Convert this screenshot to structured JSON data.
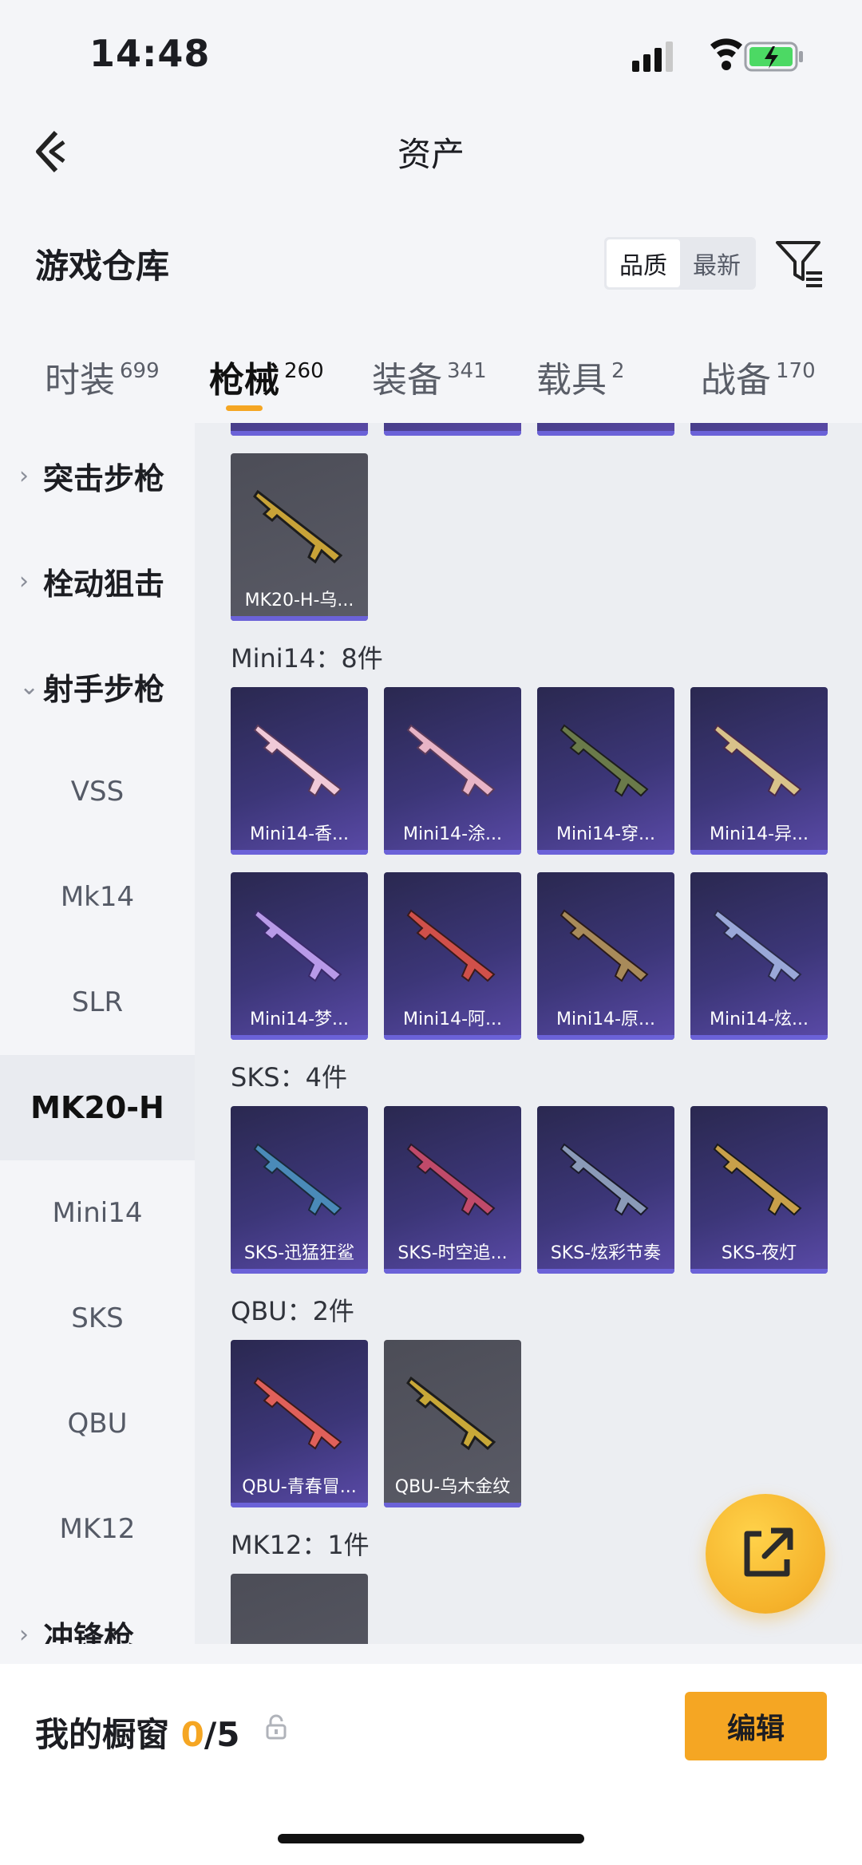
{
  "status_bar": {
    "time": "14:48"
  },
  "nav": {
    "title": "资产"
  },
  "header": {
    "title": "游戏仓库",
    "sort_options": [
      "品质",
      "最新"
    ]
  },
  "tabs": [
    {
      "label": "时装",
      "count": "699"
    },
    {
      "label": "枪械",
      "count": "260"
    },
    {
      "label": "装备",
      "count": "341"
    },
    {
      "label": "载具",
      "count": "2"
    },
    {
      "label": "战备",
      "count": "170"
    }
  ],
  "sidebar": {
    "categories": [
      "突击步枪",
      "栓动狙击",
      "射手步枪",
      "冲锋枪"
    ],
    "subitems": [
      "VSS",
      "Mk14",
      "SLR",
      "MK20-H",
      "Mini14",
      "SKS",
      "QBU",
      "MK12"
    ]
  },
  "groups": {
    "mk20h": {
      "items": [
        "MK20-H-乌..."
      ]
    },
    "mini14": {
      "label": "Mini14：8件",
      "items": [
        "Mini14-香...",
        "Mini14-涂...",
        "Mini14-穿...",
        "Mini14-异...",
        "Mini14-梦...",
        "Mini14-阿...",
        "Mini14-原...",
        "Mini14-炫..."
      ]
    },
    "sks": {
      "label": "SKS：4件",
      "items": [
        "SKS-迅猛狂鲨",
        "SKS-时空追...",
        "SKS-炫彩节奏",
        "SKS-夜灯"
      ]
    },
    "qbu": {
      "label": "QBU：2件",
      "items": [
        "QBU-青春冒...",
        "QBU-乌木金纹"
      ]
    },
    "mk12": {
      "label": "MK12：1件"
    }
  },
  "showcase": {
    "label": "我的橱窗",
    "count": "0",
    "total": "/5"
  },
  "edit_label": "编辑",
  "colors": {
    "accent": "#f5a623",
    "card_purple": "#3c3678",
    "card_gray": "#5a5b66"
  }
}
